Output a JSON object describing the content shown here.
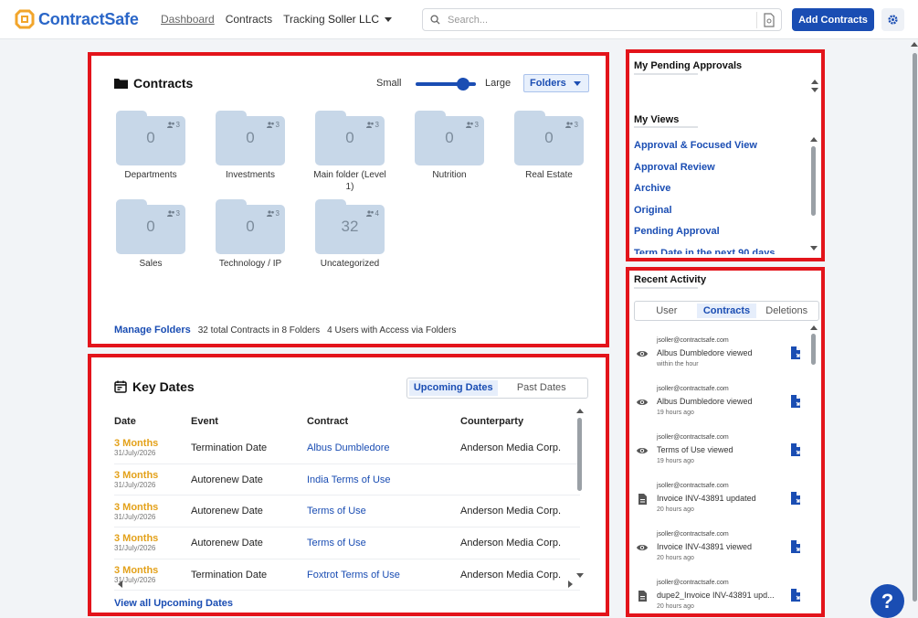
{
  "app": {
    "brand": "ContractSafe",
    "nav": [
      "Dashboard",
      "Contracts",
      "Tracking"
    ],
    "org": "Soller LLC",
    "search_placeholder": "Search...",
    "add_button": "Add Contracts",
    "help_label": "?"
  },
  "contracts": {
    "title": "Contracts",
    "size_small": "Small",
    "size_large": "Large",
    "view_select": "Folders",
    "folders": [
      {
        "name": "Departments",
        "count": "0",
        "users": "3"
      },
      {
        "name": "Investments",
        "count": "0",
        "users": "3"
      },
      {
        "name": "Main folder (Level 1)",
        "count": "0",
        "users": "3"
      },
      {
        "name": "Nutrition",
        "count": "0",
        "users": "3"
      },
      {
        "name": "Real Estate",
        "count": "0",
        "users": "3"
      },
      {
        "name": "Sales",
        "count": "0",
        "users": "3"
      },
      {
        "name": "Technology / IP",
        "count": "0",
        "users": "3"
      },
      {
        "name": "Uncategorized",
        "count": "32",
        "users": "4"
      }
    ],
    "manage_link": "Manage Folders",
    "summary_contracts": "32 total Contracts in 8 Folders",
    "summary_users": "4 Users with Access via Folders"
  },
  "key_dates": {
    "title": "Key Dates",
    "tab_upcoming": "Upcoming Dates",
    "tab_past": "Past Dates",
    "columns": [
      "Date",
      "Event",
      "Contract",
      "Counterparty"
    ],
    "rows": [
      {
        "when": "3 Months",
        "date": "31/July/2026",
        "event": "Termination Date",
        "contract": "Albus Dumbledore",
        "counterparty": "Anderson Media Corp."
      },
      {
        "when": "3 Months",
        "date": "31/July/2026",
        "event": "Autorenew Date",
        "contract": "India Terms of Use",
        "counterparty": ""
      },
      {
        "when": "3 Months",
        "date": "31/July/2026",
        "event": "Autorenew Date",
        "contract": "Terms of Use",
        "counterparty": "Anderson Media Corp."
      },
      {
        "when": "3 Months",
        "date": "31/July/2026",
        "event": "Autorenew Date",
        "contract": "Terms of Use",
        "counterparty": "Anderson Media Corp."
      },
      {
        "when": "3 Months",
        "date": "31/July/2026",
        "event": "Termination Date",
        "contract": "Foxtrot Terms of Use",
        "counterparty": "Anderson Media Corp."
      }
    ],
    "view_all": "View all Upcoming Dates"
  },
  "approvals": {
    "title": "My Pending Approvals",
    "views_title": "My Views",
    "views": [
      "Approval & Focused View",
      "Approval Review",
      "Archive",
      "Original",
      "Pending Approval",
      "Term Date in the next 90 days"
    ]
  },
  "activity": {
    "title": "Recent Activity",
    "tabs": [
      "User",
      "Contracts",
      "Deletions"
    ],
    "items": [
      {
        "user": "jsoller@contractsafe.com",
        "text": "Albus Dumbledore viewed",
        "time": "within the hour",
        "icon": "eye-icon"
      },
      {
        "user": "jsoller@contractsafe.com",
        "text": "Albus Dumbledore viewed",
        "time": "19 hours ago",
        "icon": "eye-icon"
      },
      {
        "user": "jsoller@contractsafe.com",
        "text": "Terms of Use viewed",
        "time": "19 hours ago",
        "icon": "eye-icon"
      },
      {
        "user": "jsoller@contractsafe.com",
        "text": "Invoice INV-43891 updated",
        "time": "20 hours ago",
        "icon": "document-icon"
      },
      {
        "user": "jsoller@contractsafe.com",
        "text": "Invoice INV-43891 viewed",
        "time": "20 hours ago",
        "icon": "eye-icon"
      },
      {
        "user": "jsoller@contractsafe.com",
        "text": "dupe2_Invoice INV-43891 upd...",
        "time": "20 hours ago",
        "icon": "document-icon"
      }
    ]
  },
  "colors": {
    "accent": "#1a4db3",
    "highlight": "#e3141b",
    "due": "#e3a11a",
    "folder": "#c7d7e8"
  }
}
